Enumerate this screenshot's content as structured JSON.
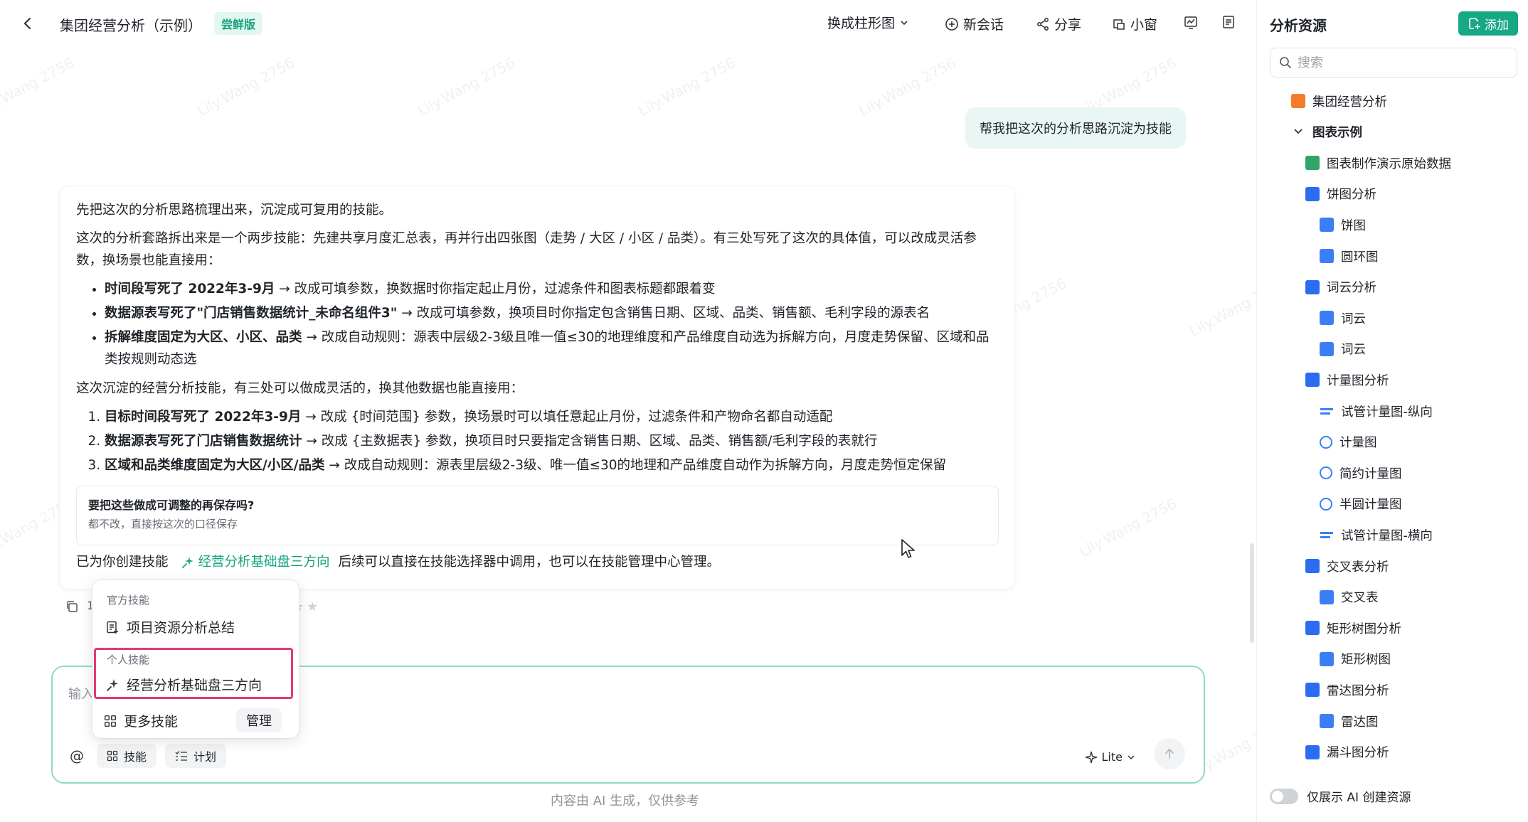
{
  "header": {
    "back_icon": "chevron-left-icon",
    "title": "集团经营分析（示例）",
    "badge": "尝鲜版",
    "switch_chart": "换成柱形图",
    "new_chat": "新会话",
    "share": "分享",
    "mini_window": "小窗"
  },
  "chat": {
    "user_message": "帮我把这次的分析思路沉淀为技能",
    "reply": {
      "intro": "先把这次的分析思路梳理出来，沉淀成可复用的技能。",
      "para1": "这次的分析套路拆出来是一个两步技能：先建共享月度汇总表，再并行出四张图（走势 / 大区 / 小区 / 品类）。有三处写死了这次的具体值，可以改成灵活参数，换场景也能直接用：",
      "bullets": [
        {
          "bold": "时间段写死了 2022年3-9月",
          "rest": " → 改成可填参数，换数据时你指定起止月份，过滤条件和图表标题都跟着变"
        },
        {
          "bold": "数据源表写死了\"门店销售数据统计_未命名组件3\"",
          "rest": " → 改成可填参数，换项目时你指定包含销售日期、区域、品类、销售额、毛利字段的源表名"
        },
        {
          "bold": "拆解维度固定为大区、小区、品类",
          "rest": " → 改成自动规则：源表中层级2-3级且唯一值≤30的地理维度和产品维度自动选为拆解方向，月度走势保留、区域和品类按规则动态选"
        }
      ],
      "para2": "这次沉淀的经营分析技能，有三处可以做成灵活的，换其他数据也能直接用：",
      "numbered": [
        {
          "bold": "目标时间段写死了 2022年3-9月",
          "rest": " → 改成 {时间范围} 参数，换场景时可以填任意起止月份，过滤条件和产物命名都自动适配"
        },
        {
          "bold": "数据源表写死了门店销售数据统计",
          "rest": " → 改成 {主数据表} 参数，换项目时只要指定含销售日期、区域、品类、销售额/毛利字段的表就行"
        },
        {
          "bold": "区域和品类维度固定为大区/小区/品类",
          "rest": " → 改成自动规则：源表里层级2-3级、唯一值≤30的地理和产品维度自动作为拆解方向，月度走势恒定保留"
        }
      ],
      "save_question": "要把这些做成可调整的再保存吗?",
      "save_answer": "都不改，直接按这次的口径保存",
      "created_prefix": "已为你创建技能",
      "created_skill": "经营分析基础盘三方向",
      "created_suffix": "后续可以直接在技能选择器中调用，也可以在技能管理中心管理。"
    },
    "copy_tail": "1"
  },
  "skill_popup": {
    "official_title": "官方技能",
    "official_item": "项目资源分析总结",
    "personal_title": "个人技能",
    "personal_item": "经营分析基础盘三方向",
    "more": "更多技能",
    "manage": "管理"
  },
  "input": {
    "placeholder": "输入",
    "skill_btn": "技能",
    "plan_btn": "计划",
    "model": "Lite",
    "disclaimer": "内容由 AI 生成，仅供参考"
  },
  "right_panel": {
    "title": "分析资源",
    "add": "添加",
    "search_placeholder": "搜索",
    "tree": [
      {
        "label": "集团经营分析",
        "level": 0,
        "icon": "dashboard-icon"
      },
      {
        "label": "图表示例",
        "level": 0,
        "icon": "chevron-down-icon",
        "bold": true
      },
      {
        "label": "图表制作演示原始数据",
        "level": 1,
        "icon": "table-icon"
      },
      {
        "label": "饼图分析",
        "level": 1,
        "icon": "analysis-icon"
      },
      {
        "label": "饼图",
        "level": 2,
        "icon": "chart-icon"
      },
      {
        "label": "圆环图",
        "level": 2,
        "icon": "chart-icon"
      },
      {
        "label": "词云分析",
        "level": 1,
        "icon": "analysis-icon"
      },
      {
        "label": "词云",
        "level": 2,
        "icon": "chart-icon"
      },
      {
        "label": "词云",
        "level": 2,
        "icon": "chart-icon"
      },
      {
        "label": "计量图分析",
        "level": 1,
        "icon": "analysis-icon"
      },
      {
        "label": "试管计量图-纵向",
        "level": 2,
        "icon": "tube-icon"
      },
      {
        "label": "计量图",
        "level": 2,
        "icon": "gauge-icon"
      },
      {
        "label": "简约计量图",
        "level": 2,
        "icon": "gauge-icon"
      },
      {
        "label": "半圆计量图",
        "level": 2,
        "icon": "gauge-icon"
      },
      {
        "label": "试管计量图-横向",
        "level": 2,
        "icon": "tube-icon"
      },
      {
        "label": "交叉表分析",
        "level": 1,
        "icon": "analysis-icon"
      },
      {
        "label": "交叉表",
        "level": 2,
        "icon": "crosstab-icon"
      },
      {
        "label": "矩形树图分析",
        "level": 1,
        "icon": "analysis-icon"
      },
      {
        "label": "矩形树图",
        "level": 2,
        "icon": "chart-icon"
      },
      {
        "label": "雷达图分析",
        "level": 1,
        "icon": "analysis-icon"
      },
      {
        "label": "雷达图",
        "level": 2,
        "icon": "chart-icon"
      },
      {
        "label": "漏斗图分析",
        "level": 1,
        "icon": "analysis-icon"
      }
    ],
    "toggle_label": "仅展示 AI 创建资源"
  },
  "watermark": "Lily.Wang 2756",
  "colors": {
    "accent": "#17a884",
    "highlight": "#e03b6c",
    "user_bubble": "#e9f7f4"
  }
}
